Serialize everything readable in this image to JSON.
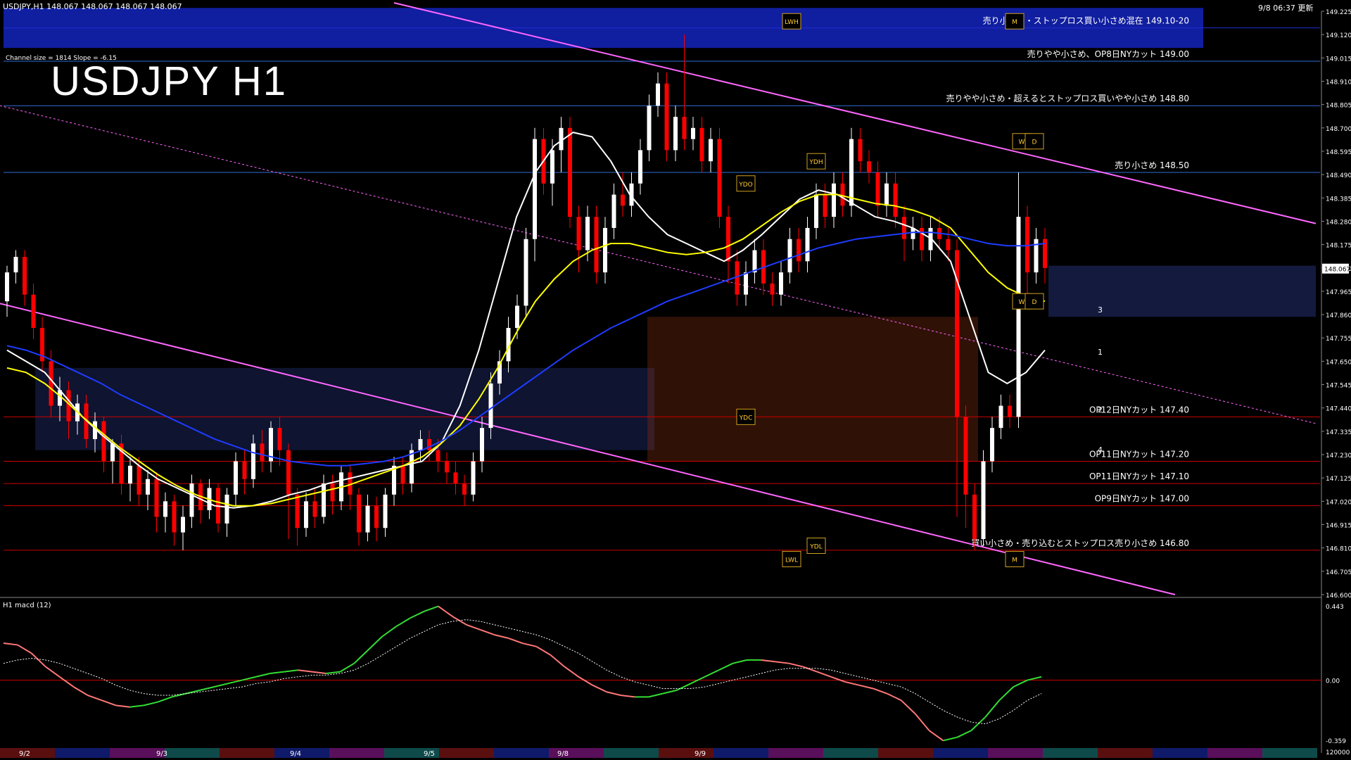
{
  "header": {
    "symbol_line": "USDJPY,H1  148.067 148.067 148.067 148.067",
    "clock": "9/8 06:37 更新",
    "channel_info": "Channel size = 1814 Slope = -6.15",
    "title": "USDJPY H1",
    "macd_label": "H1  macd (12)"
  },
  "chart_data": {
    "type": "line",
    "title": "USDJPY H1",
    "xlabel": "",
    "ylabel": "",
    "ylim": [
      146.6,
      149.225
    ],
    "current_price": "148.067",
    "price_ticks": [
      "149.225",
      "149.120",
      "149.015",
      "148.910",
      "148.805",
      "148.700",
      "148.595",
      "148.490",
      "148.385",
      "148.280",
      "148.175",
      "148.070",
      "147.965",
      "147.860",
      "147.755",
      "147.650",
      "147.545",
      "147.440",
      "147.335",
      "147.230",
      "147.125",
      "147.020",
      "146.915",
      "146.810",
      "146.705",
      "146.600"
    ],
    "date_labels": [
      "9/2",
      "9/3",
      "9/4",
      "9/5",
      "9/8",
      "9/9"
    ],
    "levels": [
      {
        "price": 149.15,
        "label": "売り小さめ・ストップロス買い小さめ混在 149.10-20",
        "color": "#1e2fd0",
        "band": true
      },
      {
        "price": 149.0,
        "label": "売りやや小さめ、OP8日NYカット 149.00",
        "color": "#2f6fd8"
      },
      {
        "price": 148.8,
        "label": "売りやや小さめ・超えるとストップロス買いやや小さめ 148.80",
        "color": "#2f6fd8"
      },
      {
        "price": 148.5,
        "label": "売り小さめ 148.50",
        "color": "#2f6fd8"
      },
      {
        "price": 147.4,
        "label": "OP12日NYカット 147.40",
        "color": "#cc0000"
      },
      {
        "price": 147.2,
        "label": "OP11日NYカット 147.20",
        "color": "#cc0000"
      },
      {
        "price": 147.1,
        "label": "OP11日NYカット 147.10",
        "color": "#cc0000"
      },
      {
        "price": 147.0,
        "label": "OP9日NYカット 147.00",
        "color": "#cc0000"
      },
      {
        "price": 146.8,
        "label": "買い小さめ・売り込むとストップロス売り小さめ 146.80",
        "color": "#cc0000"
      }
    ],
    "markers": [
      "LWH",
      "YDH",
      "YDO",
      "YDC",
      "YDL",
      "LWL",
      "W",
      "D",
      "W",
      "D",
      "M",
      "M"
    ],
    "projection_labels": [
      "3",
      "1",
      "2",
      "4"
    ],
    "candles": [
      [
        147.92,
        148.05,
        147.85,
        148.08
      ],
      [
        148.05,
        148.12,
        148.0,
        148.15
      ],
      [
        148.12,
        147.95,
        147.9,
        148.15
      ],
      [
        147.95,
        147.8,
        147.75,
        148.0
      ],
      [
        147.8,
        147.65,
        147.6,
        147.85
      ],
      [
        147.65,
        147.45,
        147.4,
        147.7
      ],
      [
        147.45,
        147.52,
        147.38,
        147.58
      ],
      [
        147.52,
        147.38,
        147.3,
        147.56
      ],
      [
        147.38,
        147.46,
        147.32,
        147.5
      ],
      [
        147.46,
        147.3,
        147.26,
        147.5
      ],
      [
        147.3,
        147.38,
        147.24,
        147.42
      ],
      [
        147.38,
        147.2,
        147.15,
        147.4
      ],
      [
        147.2,
        147.28,
        147.1,
        147.3
      ],
      [
        147.28,
        147.1,
        147.05,
        147.32
      ],
      [
        147.1,
        147.18,
        147.02,
        147.22
      ],
      [
        147.18,
        147.05,
        147.0,
        147.22
      ],
      [
        147.05,
        147.12,
        146.98,
        147.16
      ],
      [
        147.12,
        146.95,
        146.88,
        147.15
      ],
      [
        146.95,
        147.02,
        146.88,
        147.06
      ],
      [
        147.02,
        146.88,
        146.82,
        147.05
      ],
      [
        146.88,
        146.95,
        146.8,
        147.0
      ],
      [
        146.95,
        147.1,
        146.9,
        147.14
      ],
      [
        147.1,
        146.98,
        146.92,
        147.12
      ],
      [
        146.98,
        147.08,
        146.94,
        147.12
      ],
      [
        147.08,
        146.92,
        146.88,
        147.1
      ],
      [
        146.92,
        147.05,
        146.86,
        147.08
      ],
      [
        147.05,
        147.2,
        147.0,
        147.24
      ],
      [
        147.2,
        147.12,
        147.05,
        147.25
      ],
      [
        147.12,
        147.28,
        147.08,
        147.32
      ],
      [
        147.28,
        147.2,
        147.15,
        147.34
      ],
      [
        147.2,
        147.35,
        147.15,
        147.38
      ],
      [
        147.35,
        147.25,
        147.18,
        147.4
      ],
      [
        147.25,
        147.05,
        146.85,
        147.28
      ],
      [
        147.05,
        146.9,
        146.82,
        147.08
      ],
      [
        146.9,
        147.02,
        146.86,
        147.06
      ],
      [
        147.02,
        146.95,
        146.9,
        147.08
      ],
      [
        146.95,
        147.1,
        146.92,
        147.14
      ],
      [
        147.1,
        147.02,
        146.96,
        147.14
      ],
      [
        147.02,
        147.15,
        146.98,
        147.18
      ],
      [
        147.15,
        147.05,
        146.98,
        147.18
      ],
      [
        147.05,
        146.88,
        146.82,
        147.08
      ],
      [
        146.88,
        147.0,
        146.84,
        147.05
      ],
      [
        147.0,
        146.9,
        146.84,
        147.04
      ],
      [
        146.9,
        147.05,
        146.86,
        147.08
      ],
      [
        147.05,
        147.18,
        147.0,
        147.22
      ],
      [
        147.18,
        147.1,
        147.05,
        147.22
      ],
      [
        147.1,
        147.25,
        147.06,
        147.28
      ],
      [
        147.25,
        147.3,
        147.2,
        147.34
      ],
      [
        147.3,
        147.25,
        147.2,
        147.34
      ],
      [
        147.25,
        147.2,
        147.15,
        147.3
      ],
      [
        147.2,
        147.15,
        147.1,
        147.24
      ],
      [
        147.15,
        147.1,
        147.05,
        147.2
      ],
      [
        147.1,
        147.05,
        147.0,
        147.14
      ],
      [
        147.05,
        147.2,
        147.02,
        147.24
      ],
      [
        147.2,
        147.35,
        147.15,
        147.4
      ],
      [
        147.35,
        147.55,
        147.3,
        147.6
      ],
      [
        147.55,
        147.65,
        147.5,
        147.7
      ],
      [
        147.65,
        147.8,
        147.6,
        147.85
      ],
      [
        147.8,
        147.9,
        147.75,
        147.95
      ],
      [
        147.9,
        148.2,
        147.85,
        148.25
      ],
      [
        148.2,
        148.65,
        148.1,
        148.7
      ],
      [
        148.65,
        148.45,
        148.4,
        148.7
      ],
      [
        148.45,
        148.6,
        148.35,
        148.65
      ],
      [
        148.6,
        148.7,
        148.5,
        148.75
      ],
      [
        148.7,
        148.3,
        148.25,
        148.75
      ],
      [
        148.3,
        148.15,
        148.05,
        148.35
      ],
      [
        148.15,
        148.3,
        148.1,
        148.35
      ],
      [
        148.3,
        148.05,
        148.0,
        148.35
      ],
      [
        148.05,
        148.25,
        148.0,
        148.3
      ],
      [
        148.25,
        148.4,
        148.2,
        148.45
      ],
      [
        148.4,
        148.35,
        148.3,
        148.5
      ],
      [
        148.35,
        148.45,
        148.3,
        148.5
      ],
      [
        148.45,
        148.6,
        148.4,
        148.65
      ],
      [
        148.6,
        148.8,
        148.55,
        148.85
      ],
      [
        148.8,
        148.9,
        148.75,
        148.95
      ],
      [
        148.9,
        148.6,
        148.55,
        148.95
      ],
      [
        148.6,
        148.75,
        148.55,
        148.8
      ],
      [
        148.75,
        148.65,
        148.6,
        149.12
      ],
      [
        148.65,
        148.7,
        148.6,
        148.75
      ],
      [
        148.7,
        148.55,
        148.5,
        148.75
      ],
      [
        148.55,
        148.65,
        148.5,
        148.7
      ],
      [
        148.65,
        148.3,
        148.25,
        148.7
      ],
      [
        148.3,
        148.1,
        148.0,
        148.35
      ],
      [
        148.1,
        147.95,
        147.9,
        148.15
      ],
      [
        147.95,
        148.05,
        147.9,
        148.1
      ],
      [
        148.05,
        148.15,
        148.0,
        148.2
      ],
      [
        148.15,
        148.0,
        147.95,
        148.2
      ],
      [
        148.0,
        147.95,
        147.9,
        148.05
      ],
      [
        147.95,
        148.05,
        147.9,
        148.1
      ],
      [
        148.05,
        148.2,
        148.0,
        148.25
      ],
      [
        148.2,
        148.1,
        148.05,
        148.25
      ],
      [
        148.1,
        148.25,
        148.05,
        148.3
      ],
      [
        148.25,
        148.4,
        148.2,
        148.45
      ],
      [
        148.4,
        148.3,
        148.25,
        148.45
      ],
      [
        148.3,
        148.45,
        148.25,
        148.5
      ],
      [
        148.45,
        148.35,
        148.3,
        148.5
      ],
      [
        148.35,
        148.65,
        148.3,
        148.7
      ],
      [
        148.65,
        148.55,
        148.5,
        148.7
      ],
      [
        148.55,
        148.5,
        148.45,
        148.6
      ],
      [
        148.5,
        148.35,
        148.3,
        148.55
      ],
      [
        148.35,
        148.45,
        148.3,
        148.5
      ],
      [
        148.45,
        148.3,
        148.25,
        148.5
      ],
      [
        148.3,
        148.2,
        148.1,
        148.35
      ],
      [
        148.2,
        148.25,
        148.15,
        148.3
      ],
      [
        148.25,
        148.15,
        148.1,
        148.3
      ],
      [
        148.15,
        148.25,
        148.1,
        148.3
      ],
      [
        148.25,
        148.2,
        148.15,
        148.3
      ],
      [
        148.2,
        148.15,
        148.1,
        148.25
      ],
      [
        148.15,
        147.4,
        146.95,
        148.2
      ],
      [
        147.4,
        147.05,
        146.9,
        147.45
      ],
      [
        147.05,
        146.85,
        146.8,
        147.1
      ],
      [
        146.85,
        147.2,
        146.82,
        147.25
      ],
      [
        147.2,
        147.35,
        147.15,
        147.4
      ],
      [
        147.35,
        147.45,
        147.3,
        147.5
      ],
      [
        147.45,
        147.4,
        147.35,
        147.5
      ],
      [
        147.4,
        148.3,
        147.35,
        148.5
      ],
      [
        148.3,
        148.05,
        147.95,
        148.35
      ],
      [
        148.05,
        148.2,
        148.0,
        148.25
      ],
      [
        148.2,
        148.07,
        148.0,
        148.25
      ]
    ],
    "series": [
      {
        "values": [
          147.7,
          147.65,
          147.6,
          147.5,
          147.4,
          147.32,
          147.25,
          147.18,
          147.12,
          147.08,
          147.04,
          147.0,
          146.99,
          147.0,
          147.02,
          147.05,
          147.07,
          147.1,
          147.12,
          147.14,
          147.16,
          147.18,
          147.2,
          147.28,
          147.45,
          147.7,
          148.0,
          148.3,
          148.5,
          148.62,
          148.68,
          148.66,
          148.55,
          148.4,
          148.3,
          148.22,
          148.18,
          148.14,
          148.1,
          148.15,
          148.22,
          148.3,
          148.38,
          148.42,
          148.4,
          148.35,
          148.3,
          148.28,
          148.25,
          148.2,
          148.1,
          147.85,
          147.6,
          147.55,
          147.6,
          147.7
        ]
      },
      {
        "values": [
          147.62,
          147.6,
          147.55,
          147.48,
          147.4,
          147.33,
          147.26,
          147.2,
          147.14,
          147.09,
          147.05,
          147.02,
          147.0,
          147.0,
          147.01,
          147.03,
          147.05,
          147.07,
          147.09,
          147.12,
          147.15,
          147.18,
          147.22,
          147.28,
          147.36,
          147.48,
          147.62,
          147.78,
          147.92,
          148.02,
          148.1,
          148.15,
          148.18,
          148.18,
          148.16,
          148.14,
          148.13,
          148.14,
          148.16,
          148.2,
          148.26,
          148.32,
          148.37,
          148.4,
          148.4,
          148.38,
          148.36,
          148.35,
          148.33,
          148.3,
          148.25,
          148.15,
          148.05,
          147.98,
          147.94,
          147.92
        ]
      },
      {
        "values": [
          147.72,
          147.7,
          147.67,
          147.63,
          147.59,
          147.55,
          147.5,
          147.46,
          147.42,
          147.38,
          147.34,
          147.3,
          147.27,
          147.24,
          147.22,
          147.2,
          147.19,
          147.18,
          147.18,
          147.19,
          147.2,
          147.22,
          147.25,
          147.29,
          147.34,
          147.4,
          147.46,
          147.52,
          147.58,
          147.64,
          147.7,
          147.75,
          147.8,
          147.84,
          147.88,
          147.92,
          147.95,
          147.98,
          148.01,
          148.04,
          148.07,
          148.1,
          148.13,
          148.16,
          148.18,
          148.2,
          148.21,
          148.22,
          148.23,
          148.23,
          148.22,
          148.2,
          148.18,
          148.17,
          148.17,
          148.18
        ]
      },
      {
        "values": [
          0.22,
          0.21,
          0.16,
          0.08,
          0.02,
          -0.04,
          -0.09,
          -0.12,
          -0.15,
          -0.16,
          -0.15,
          -0.13,
          -0.1,
          -0.08,
          -0.06,
          -0.04,
          -0.02,
          0.0,
          0.02,
          0.04,
          0.05,
          0.06,
          0.05,
          0.04,
          0.05,
          0.1,
          0.18,
          0.26,
          0.32,
          0.37,
          0.41,
          0.44,
          0.38,
          0.33,
          0.3,
          0.27,
          0.25,
          0.22,
          0.2,
          0.15,
          0.08,
          0.02,
          -0.03,
          -0.07,
          -0.09,
          -0.1,
          -0.1,
          -0.08,
          -0.06,
          -0.02,
          0.02,
          0.06,
          0.1,
          0.12,
          0.12,
          0.11,
          0.1,
          0.08,
          0.05,
          0.02,
          -0.01,
          -0.03,
          -0.05,
          -0.08,
          -0.12,
          -0.2,
          -0.3,
          -0.36,
          -0.34,
          -0.3,
          -0.22,
          -0.12,
          -0.04,
          0.0,
          0.02
        ]
      },
      {
        "values": [
          0.1,
          0.12,
          0.13,
          0.12,
          0.1,
          0.07,
          0.04,
          0.01,
          -0.03,
          -0.06,
          -0.08,
          -0.09,
          -0.09,
          -0.08,
          -0.07,
          -0.06,
          -0.05,
          -0.04,
          -0.02,
          -0.01,
          0.01,
          0.02,
          0.03,
          0.03,
          0.04,
          0.06,
          0.1,
          0.15,
          0.2,
          0.25,
          0.29,
          0.33,
          0.35,
          0.36,
          0.35,
          0.33,
          0.31,
          0.29,
          0.27,
          0.24,
          0.2,
          0.16,
          0.11,
          0.06,
          0.02,
          -0.01,
          -0.03,
          -0.05,
          -0.05,
          -0.05,
          -0.04,
          -0.02,
          0.0,
          0.02,
          0.04,
          0.06,
          0.07,
          0.07,
          0.07,
          0.06,
          0.04,
          0.02,
          0.0,
          -0.02,
          -0.04,
          -0.08,
          -0.13,
          -0.18,
          -0.22,
          -0.25,
          -0.26,
          -0.23,
          -0.18,
          -0.12,
          -0.08
        ]
      }
    ],
    "macd": {
      "ylim": [
        -0.4,
        0.48
      ],
      "ticks": [
        "0.443",
        "0.00",
        "-0.359"
      ],
      "scale_label": "120000"
    },
    "colors": {
      "bull": "#ffffff",
      "bear": "#ff0000",
      "ma_fast": "#ffffff",
      "ma_mid": "#ffff00",
      "ma_slow": "#1e3cff",
      "macd_pos": "#33dd33",
      "macd_neg": "#ff7777",
      "signal": "#ffffff",
      "channel": "#ff66ff",
      "rsi": "#22aa22"
    }
  }
}
